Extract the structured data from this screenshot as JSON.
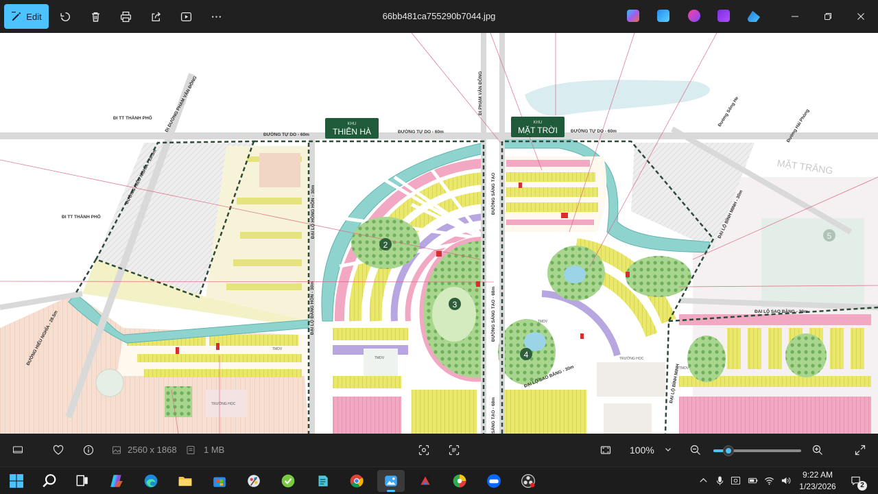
{
  "window": {
    "file_name": "66bb481ca755290b7044.jpg",
    "edit_label": "Edit"
  },
  "toolbar": {
    "icons": [
      "edit-icon",
      "rotate-icon",
      "delete-icon",
      "print-icon",
      "share-icon",
      "slideshow-icon",
      "more-icon"
    ]
  },
  "map": {
    "zone_labels": {
      "thien_ha_small": "KHU",
      "thien_ha": "THIÊN HÀ",
      "mat_troi_small": "KHU",
      "mat_troi": "MẶT TRỜI",
      "mat_trang": "MẶT TRĂNG"
    },
    "road_labels": {
      "di_tt_thanh_pho_top": "ĐI TT THÀNH PHỐ",
      "di_tt_thanh_pho_left": "ĐI TT THÀNH PHỐ",
      "di_duong_pham_van_dong": "ĐI ĐƯỜNG PHẠM VĂN ĐỒNG",
      "duong_tu_do_1": "ĐƯỜNG TỰ DO - 60m",
      "duong_tu_do_2": "ĐƯỜNG TỰ DO - 60m",
      "duong_tu_do_3": "ĐƯỜNG TỰ DO - 60m",
      "di_pham_van_dong": "ĐI PHẠM VĂN ĐỒNG",
      "duong_song_he": "Đường Sông He",
      "duong_hai_phong": "Đường Hải Phòng",
      "duong_hieu_nghia_top": "ĐƯỜNG HIẾU NGHĨA - 28.5m",
      "duong_hieu_nghia_left": "ĐƯỜNG HIẾU NGHĨA - 28.5m",
      "dai_lo_hong_hon": "ĐẠI LỘ HỒNG HỒN - 30m",
      "dai_lo_dang_hon": "ĐẠI LỘ ĐĂNG HỒN - 30m",
      "duong_sang_tao_top": "ĐƯỜNG SÁNG TẠO",
      "duong_sang_tao_mid": "ĐƯỜNG SÁNG TẠO - 68m",
      "duong_sang_tao_bottom": "SÁNG TẠO - 68m",
      "dai_lo_sao_bang_right": "ĐẠI LỘ SAO BĂNG - 30m",
      "dai_lo_sao_bang_mid": "ĐẠI LỘ SAO BĂNG - 30m",
      "dai_lo_binh_minh": "ĐẠI LỘ BÌNH MINH - 30m",
      "dai_lo_binh_minh_lower": "ĐẠI LỘ BÌNH MINH"
    },
    "park_numbers": [
      "2",
      "3",
      "4",
      "5"
    ],
    "facility_labels": {
      "tmdv_1": "TMDV",
      "tmdv_2": "TMDV",
      "tmdv_3": "TMDV",
      "tmdv_4": "TMDV",
      "truong_hoc_1": "TRƯỜNG HỌC",
      "truong_hoc_2": "TRƯỜNG HỌC"
    }
  },
  "infobar": {
    "dimensions": "2560 x 1868",
    "file_size": "1 MB",
    "zoom": "100%",
    "zoom_slider_fraction": 0.17
  },
  "taskbar": {
    "apps": [
      "windows-start",
      "search",
      "task-view",
      "copilot",
      "edge",
      "file-explorer",
      "microsoft-store",
      "photos-app",
      "greenshot",
      "notepad",
      "chrome",
      "photos",
      "powerpoint",
      "coccoc",
      "zalo",
      "obs"
    ],
    "active_app": "photos",
    "time": "9:22 AM",
    "date": "1/23/2026",
    "notification_count": "2"
  },
  "colors": {
    "accent": "#4cc2ff",
    "canal": "#8fd3cf",
    "villa_yellow": "#e9e86a",
    "villa_pink": "#f2a8c2",
    "villa_purple": "#b8a6e0",
    "zone_badge_green": "#1f5a3a",
    "park_green": "#7cc06a"
  }
}
